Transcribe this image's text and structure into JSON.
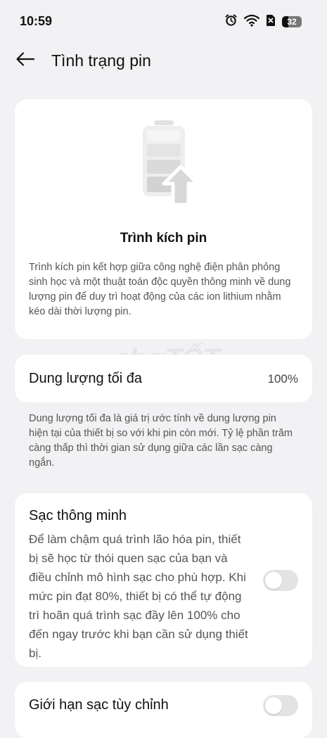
{
  "status_bar": {
    "time": "10:59",
    "battery_level": "32",
    "icons": [
      "alarm-icon",
      "wifi-icon",
      "sim-off-icon",
      "battery-icon"
    ]
  },
  "header": {
    "back_icon": "arrow-left-icon",
    "title": "Tình trạng pin"
  },
  "hero": {
    "icon": "battery-charging-arrow-icon",
    "title": "Trình kích pin",
    "description": "Trình kích pin kết hợp giữa công nghệ điện phân phỏng sinh học và một thuật toán độc quyền thông minh về dung lượng pin để duy trì hoạt động của các ion lithium nhằm kéo dài thời lượng pin."
  },
  "capacity": {
    "label": "Dung lượng tối đa",
    "value": "100%",
    "note": "Dung lượng tối đa là giá trị ước tính về dung lượng pin hiện tại của thiết bị so với khi pin còn mới. Tỷ lệ phần trăm càng thấp thì thời gian sử dụng giữa các lần sạc càng ngắn."
  },
  "smart_charging": {
    "title": "Sạc thông minh",
    "description": "Để làm chậm quá trình lão hóa pin, thiết bị sẽ học từ thói quen sạc của bạn và điều chỉnh mô hình sạc cho phù hợp. Khi mức pin đạt 80%, thiết bị có thể tự động trì hoãn quá trình sạc đầy lên 100% cho đến ngay trước khi bạn cần sử dụng thiết bị.",
    "enabled": false
  },
  "custom_limit": {
    "title": "Giới hạn sạc tùy chỉnh",
    "enabled": false
  },
  "watermark": "chợTỐT"
}
